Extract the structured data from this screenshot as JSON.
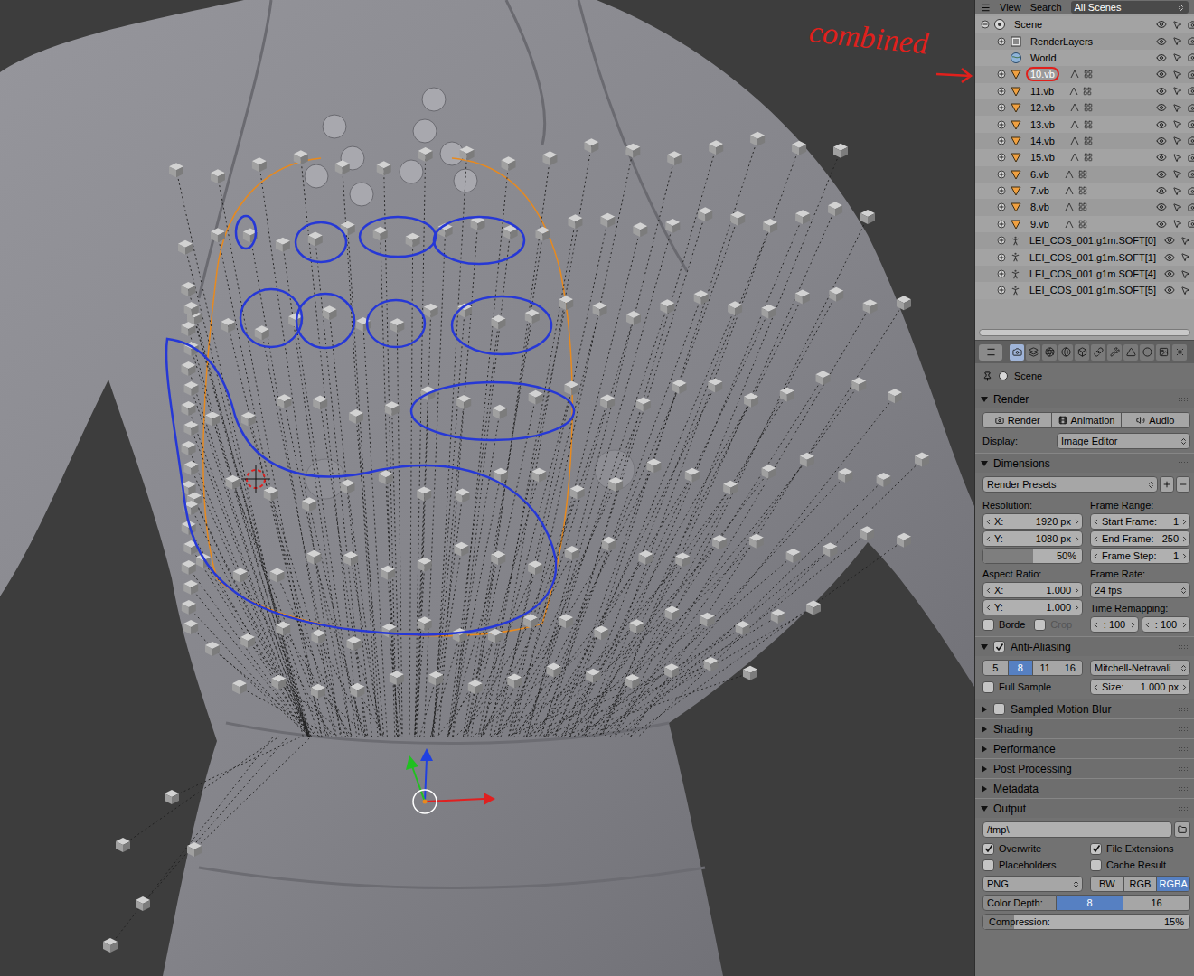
{
  "viewport": {
    "annotations": [
      {
        "text": "combined",
        "color": "#e0201c",
        "target": "10.vb"
      }
    ]
  },
  "outliner": {
    "header": {
      "menus": [
        "View",
        "Search"
      ],
      "scope": "All Scenes"
    },
    "items": [
      {
        "label": "Scene",
        "kind": "scene",
        "expanded": true,
        "selected": false
      },
      {
        "label": "RenderLayers",
        "kind": "renderlayers",
        "expanded": false,
        "selected": false
      },
      {
        "label": "World",
        "kind": "world",
        "selected": false
      },
      {
        "label": "10.vb",
        "kind": "mesh",
        "expanded": false,
        "selected": true
      },
      {
        "label": "11.vb",
        "kind": "mesh",
        "expanded": false,
        "selected": false
      },
      {
        "label": "12.vb",
        "kind": "mesh",
        "expanded": false,
        "selected": false
      },
      {
        "label": "13.vb",
        "kind": "mesh",
        "expanded": false,
        "selected": false
      },
      {
        "label": "14.vb",
        "kind": "mesh",
        "expanded": false,
        "selected": false
      },
      {
        "label": "15.vb",
        "kind": "mesh",
        "expanded": false,
        "selected": false
      },
      {
        "label": "6.vb",
        "kind": "mesh",
        "expanded": false,
        "selected": false
      },
      {
        "label": "7.vb",
        "kind": "mesh",
        "expanded": false,
        "selected": false
      },
      {
        "label": "8.vb",
        "kind": "mesh",
        "expanded": false,
        "selected": false
      },
      {
        "label": "9.vb",
        "kind": "mesh",
        "expanded": false,
        "selected": false
      },
      {
        "label": "LEI_COS_001.g1m.SOFT[0]",
        "kind": "armature",
        "expanded": false,
        "selected": false
      },
      {
        "label": "LEI_COS_001.g1m.SOFT[1]",
        "kind": "armature",
        "expanded": false,
        "selected": false
      },
      {
        "label": "LEI_COS_001.g1m.SOFT[4]",
        "kind": "armature",
        "expanded": false,
        "selected": false
      },
      {
        "label": "LEI_COS_001.g1m.SOFT[5]",
        "kind": "armature",
        "expanded": false,
        "selected": false
      }
    ]
  },
  "properties": {
    "context_tabs": [
      {
        "selected": true
      },
      {
        "selected": false
      },
      {
        "selected": false
      },
      {
        "selected": false
      },
      {
        "selected": false
      },
      {
        "selected": false
      },
      {
        "selected": false
      },
      {
        "selected": false
      },
      {
        "selected": false
      },
      {
        "selected": false
      },
      {
        "selected": false
      }
    ],
    "breadcrumb": "Scene",
    "render": {
      "title": "Render",
      "expanded": true,
      "buttons": [
        "Render",
        "Animation",
        "Audio"
      ],
      "display": {
        "label": "Display:",
        "value": "Image Editor"
      }
    },
    "dimensions": {
      "title": "Dimensions",
      "expanded": true,
      "presets": "Render Presets",
      "left": [
        {
          "kind": "label",
          "text": "Resolution:"
        },
        {
          "kind": "number",
          "label": "X:",
          "value": "1920 px"
        },
        {
          "kind": "number",
          "label": "Y:",
          "value": "1080 px"
        },
        {
          "kind": "slider",
          "value": "50%",
          "level": 0.5
        },
        {
          "kind": "label",
          "text": "Aspect Ratio:"
        },
        {
          "kind": "number",
          "label": "X:",
          "value": "1.000"
        },
        {
          "kind": "number",
          "label": "Y:",
          "value": "1.000"
        },
        {
          "kind": "checks",
          "items": [
            {
              "label": "Borde",
              "checked": false,
              "disabled": false
            },
            {
              "label": "Crop",
              "checked": false,
              "disabled": true
            }
          ]
        }
      ],
      "right": [
        {
          "kind": "label",
          "text": "Frame Range:"
        },
        {
          "kind": "number",
          "label": "Start Frame:",
          "value": "1"
        },
        {
          "kind": "number",
          "label": "End Frame:",
          "value": "250"
        },
        {
          "kind": "number",
          "label": "Frame Step:",
          "value": "1"
        },
        {
          "kind": "label",
          "text": "Frame Rate:"
        },
        {
          "kind": "dropdown",
          "value": "24 fps"
        },
        {
          "kind": "label",
          "text": "Time Remapping:"
        },
        {
          "kind": "pair",
          "values": [
            ": 100",
            ": 100"
          ]
        }
      ]
    },
    "anti_aliasing": {
      "title": "Anti-Aliasing",
      "expanded": true,
      "checked": true,
      "samples": [
        {
          "label": "5",
          "selected": false
        },
        {
          "label": "8",
          "selected": true
        },
        {
          "label": "11",
          "selected": false
        },
        {
          "label": "16",
          "selected": false
        }
      ],
      "filter": "Mitchell-Netravali",
      "full_sample": {
        "label": "Full Sample",
        "checked": false
      },
      "size": {
        "label": "Size:",
        "value": "1.000 px"
      }
    },
    "collapsed": [
      {
        "title": "Sampled Motion Blur",
        "expanded": false,
        "kind": "checkbox",
        "checked": false
      },
      {
        "title": "Shading",
        "expanded": false,
        "kind": "plain"
      },
      {
        "title": "Performance",
        "expanded": false,
        "kind": "plain"
      },
      {
        "title": "Post Processing",
        "expanded": false,
        "kind": "plain"
      },
      {
        "title": "Metadata",
        "expanded": false,
        "kind": "plain"
      }
    ],
    "output": {
      "title": "Output",
      "expanded": true,
      "path": "/tmp\\",
      "checks": [
        {
          "label": "Overwrite",
          "checked": true
        },
        {
          "label": "File Extensions",
          "checked": true
        },
        {
          "label": "Placeholders",
          "checked": false
        },
        {
          "label": "Cache Result",
          "checked": false
        }
      ],
      "format": "PNG",
      "color_modes": [
        {
          "label": "BW",
          "selected": false
        },
        {
          "label": "RGB",
          "selected": false
        },
        {
          "label": "RGBA",
          "selected": true
        }
      ],
      "color_depth": {
        "label": "Color Depth:",
        "options": [
          {
            "label": "8",
            "selected": true
          },
          {
            "label": "16",
            "selected": false
          }
        ]
      },
      "compression": {
        "label": "Compression:",
        "value": "15%",
        "level": 0.15
      }
    }
  }
}
